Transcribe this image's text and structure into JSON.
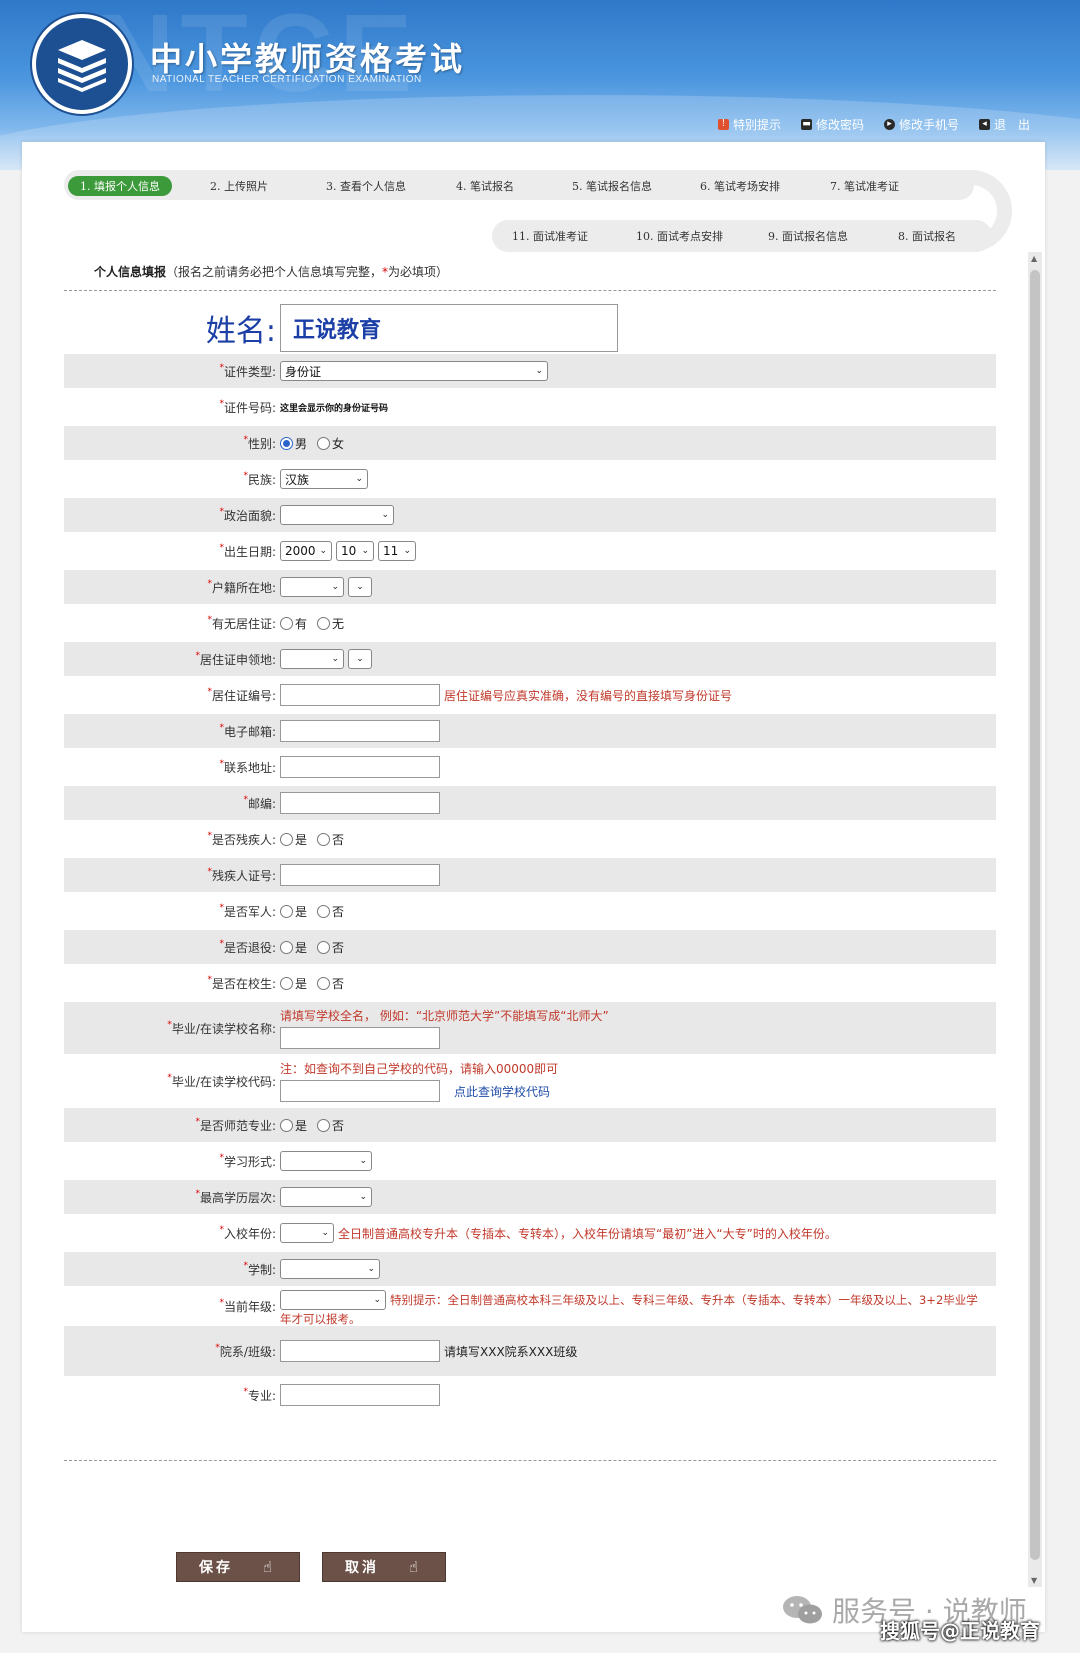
{
  "header": {
    "watermark": "NTCE",
    "title": "中小学教师资格考试",
    "subtitle": "NATIONAL TEACHER CERTIFICATION EXAMINATION",
    "links": [
      {
        "label": "特别提示",
        "icon": "alert-icon",
        "color": "#e0502f"
      },
      {
        "label": "修改密码",
        "icon": "key-icon",
        "color": "#2a2a2a"
      },
      {
        "label": "修改手机号",
        "icon": "phone-icon",
        "color": "#2a2a2a"
      },
      {
        "label": "退　出",
        "icon": "logout-icon",
        "color": "#2a2a2a"
      }
    ]
  },
  "steps": {
    "top": [
      "1. 填报个人信息",
      "2. 上传照片",
      "3. 查看个人信息",
      "4. 笔试报名",
      "5. 笔试报名信息",
      "6. 笔试考场安排",
      "7. 笔试准考证"
    ],
    "bottom": [
      "11. 面试准考证",
      "10. 面试考点安排",
      "9. 面试报名信息",
      "8. 面试报名"
    ],
    "active_color": "#3d9a3a"
  },
  "section": {
    "title": "个人信息填报",
    "note": "（报名之前请务必把个人信息填写完整，",
    "note_star": "*",
    "note_end": "为必填项）"
  },
  "form": {
    "name_label": "姓名:",
    "name_value": "正说教育",
    "id_type": {
      "label": "证件类型:",
      "value": "身份证"
    },
    "id_number": {
      "label": "证件号码:",
      "value": "这里会显示你的身份证号码"
    },
    "gender": {
      "label": "性别:",
      "options": [
        "男",
        "女"
      ],
      "selected": "男"
    },
    "ethnicity": {
      "label": "民族:",
      "value": "汉族"
    },
    "political": {
      "label": "政治面貌:",
      "value": ""
    },
    "birth": {
      "label": "出生日期:",
      "year": "2000",
      "month": "10",
      "day": "11"
    },
    "hukou": {
      "label": "户籍所在地:"
    },
    "residence_permit": {
      "label": "有无居住证:",
      "options": [
        "有",
        "无"
      ]
    },
    "permit_place": {
      "label": "居住证申领地:"
    },
    "permit_number": {
      "label": "居住证编号:",
      "hint": "居住证编号应真实准确，没有编号的直接填写身份证号"
    },
    "email": {
      "label": "电子邮箱:"
    },
    "address": {
      "label": "联系地址:"
    },
    "postcode": {
      "label": "邮编:"
    },
    "disabled": {
      "label": "是否残疾人:",
      "options": [
        "是",
        "否"
      ]
    },
    "disabled_id": {
      "label": "残疾人证号:"
    },
    "military": {
      "label": "是否军人:",
      "options": [
        "是",
        "否"
      ]
    },
    "retired": {
      "label": "是否退役:",
      "options": [
        "是",
        "否"
      ]
    },
    "student": {
      "label": "是否在校生:",
      "options": [
        "是",
        "否"
      ]
    },
    "school_name": {
      "label": "毕业/在读学校名称:",
      "hint": "请填写学校全名，  例如：“北京师范大学”不能填写成“北师大”"
    },
    "school_code": {
      "label": "毕业/在读学校代码:",
      "hint": "注：如查询不到自己学校的代码，请输入00000即可",
      "link": "点此查询学校代码"
    },
    "normal_major": {
      "label": "是否师范专业:",
      "options": [
        "是",
        "否"
      ]
    },
    "study_form": {
      "label": "学习形式:"
    },
    "education": {
      "label": "最高学历层次:"
    },
    "enroll_year": {
      "label": "入校年份:",
      "hint": "全日制普通高校专升本（专插本、专转本），入校年份请填写“最初”进入“大专”时的入校年份。"
    },
    "schooling": {
      "label": "学制:"
    },
    "grade": {
      "label": "当前年级:",
      "hint1": "特别提示：全日制普通高校本科三年级及以上、专科三年级、专升本（专插本、专转本）一年级及以上、3+2毕业学",
      "hint2": "年才可以报考。"
    },
    "department": {
      "label": "院系/班级:",
      "hint": "请填写XXX院系XXX班级"
    },
    "major": {
      "label": "专业:"
    }
  },
  "buttons": {
    "save": "保存",
    "cancel": "取消"
  },
  "watermarks": {
    "service": "服务号 · 说教师",
    "sohu": "搜狐号@正说教育"
  }
}
